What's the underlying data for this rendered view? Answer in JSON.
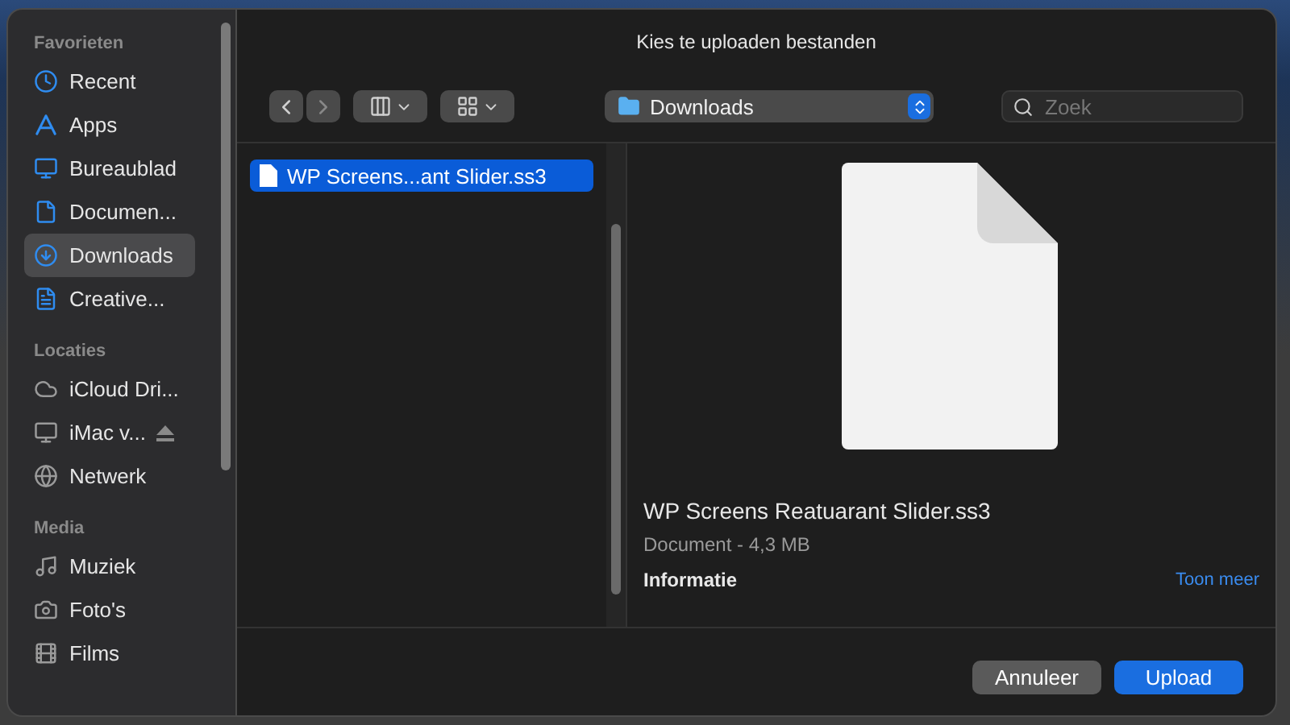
{
  "dialog": {
    "title": "Kies te uploaden bestanden"
  },
  "sidebar": {
    "sections": [
      {
        "heading": "Favorieten",
        "items": [
          {
            "label": "Recent",
            "selected": false
          },
          {
            "label": "Apps",
            "selected": false
          },
          {
            "label": "Bureaublad",
            "selected": false
          },
          {
            "label": "Documen...",
            "selected": false
          },
          {
            "label": "Downloads",
            "selected": true
          },
          {
            "label": "Creative...",
            "selected": false
          }
        ]
      },
      {
        "heading": "Locaties",
        "items": [
          {
            "label": "iCloud Dri...",
            "selected": false
          },
          {
            "label": "iMac v...",
            "selected": false,
            "ejectable": true
          },
          {
            "label": "Netwerk",
            "selected": false
          }
        ]
      },
      {
        "heading": "Media",
        "items": [
          {
            "label": "Muziek",
            "selected": false
          },
          {
            "label": "Foto's",
            "selected": false
          },
          {
            "label": "Films",
            "selected": false
          }
        ]
      }
    ]
  },
  "toolbar": {
    "location": "Downloads",
    "search": {
      "placeholder": "Zoek"
    }
  },
  "file_list": [
    {
      "name": "WP Screens...ant Slider.ss3",
      "selected": true
    }
  ],
  "preview": {
    "name": "WP Screens Reatuarant Slider.ss3",
    "meta": "Document - 4,3 MB",
    "info_heading": "Informatie",
    "more_link": "Toon meer"
  },
  "buttons": [
    {
      "label": "Annuleer",
      "kind": "secondary"
    },
    {
      "label": "Upload",
      "kind": "primary"
    }
  ]
}
